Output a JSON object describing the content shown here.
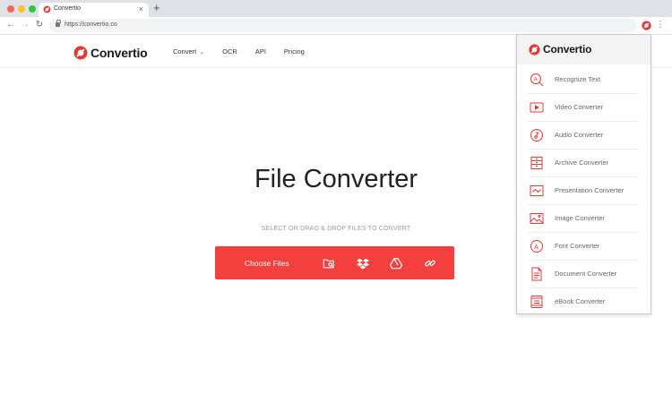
{
  "browser": {
    "tab_title": "Convertio",
    "tab_close": "×",
    "new_tab": "+",
    "url": "https://convertio.co",
    "menu_glyph": "⋮",
    "nav_glyphs": {
      "back": "←",
      "forward": "→",
      "reload": "↻"
    }
  },
  "brand": {
    "name": "Convertio",
    "accent": "#f43f3f",
    "mark_color": "#e53935"
  },
  "nav": {
    "items": [
      {
        "label": "Convert",
        "has_chevron": true
      },
      {
        "label": "OCR"
      },
      {
        "label": "API"
      },
      {
        "label": "Pricing"
      }
    ],
    "chevron": "⌄"
  },
  "hero": {
    "title": "File Converter",
    "hint": "SELECT OR DRAG & DROP FILES TO CONVERT"
  },
  "upload": {
    "label": "Choose Files",
    "sources": [
      "folder-search-icon",
      "dropbox-icon",
      "google-drive-icon",
      "url-link-icon"
    ]
  },
  "panel": {
    "title": "Convertio",
    "items": [
      {
        "label": "Recognize Text",
        "icon": "ocr-magnifier-icon"
      },
      {
        "label": "Video Converter",
        "icon": "video-icon"
      },
      {
        "label": "Audio Converter",
        "icon": "audio-icon"
      },
      {
        "label": "Archive Converter",
        "icon": "archive-icon"
      },
      {
        "label": "Presentation Converter",
        "icon": "presentation-icon"
      },
      {
        "label": "Image Converter",
        "icon": "image-icon"
      },
      {
        "label": "Font Converter",
        "icon": "font-icon"
      },
      {
        "label": "Document Converter",
        "icon": "document-icon"
      },
      {
        "label": "eBook Converter",
        "icon": "ebook-icon"
      }
    ]
  }
}
